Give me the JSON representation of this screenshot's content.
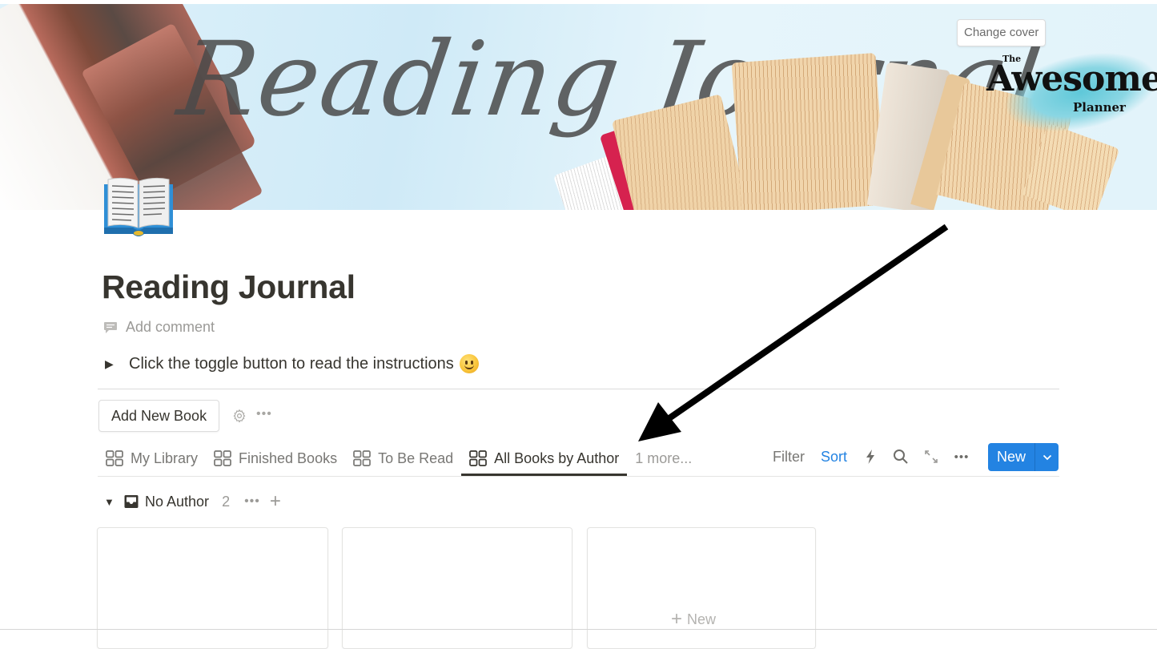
{
  "cover": {
    "script_title": "Reading Journal",
    "brand": {
      "the": "The",
      "name": "Awesome",
      "sub": "Planner"
    },
    "change_cover_label": "Change cover",
    "colors": {
      "sky": "#d6eef8",
      "brush": "#5fc8d9",
      "bookmark": "#d6224f"
    }
  },
  "page": {
    "icon": "open-book-icon",
    "title": "Reading Journal",
    "add_comment_label": "Add comment",
    "toggle_text": "Click the toggle button to read the instructions",
    "toggle_emoji": "slightly-smiling-face"
  },
  "actions": {
    "add_book_label": "Add New Book",
    "settings_icon": "gear-icon",
    "more_icon": "ellipsis-icon"
  },
  "database": {
    "tabs": [
      {
        "label": "My Library",
        "icon": "board-grid-icon",
        "active": false
      },
      {
        "label": "Finished Books",
        "icon": "board-grid-icon",
        "active": false
      },
      {
        "label": "To Be Read",
        "icon": "board-grid-icon",
        "active": false
      },
      {
        "label": "All Books by Author",
        "icon": "board-grid-icon",
        "active": true
      }
    ],
    "more_tabs_label": "1 more...",
    "toolbar": {
      "filter_label": "Filter",
      "sort_label": "Sort",
      "icons": [
        "lightning-icon",
        "search-icon",
        "expand-icon",
        "ellipsis-icon"
      ],
      "new_label": "New",
      "accent_color": "#2383e2"
    },
    "group": {
      "name": "No Author",
      "count": "2",
      "icon": "inbox-icon"
    },
    "cards": [
      {
        "title": ""
      },
      {
        "title": ""
      }
    ],
    "new_card_label": "New"
  },
  "annotation": {
    "type": "arrow",
    "points_to": "All Books by Author tab",
    "color": "#000000"
  }
}
